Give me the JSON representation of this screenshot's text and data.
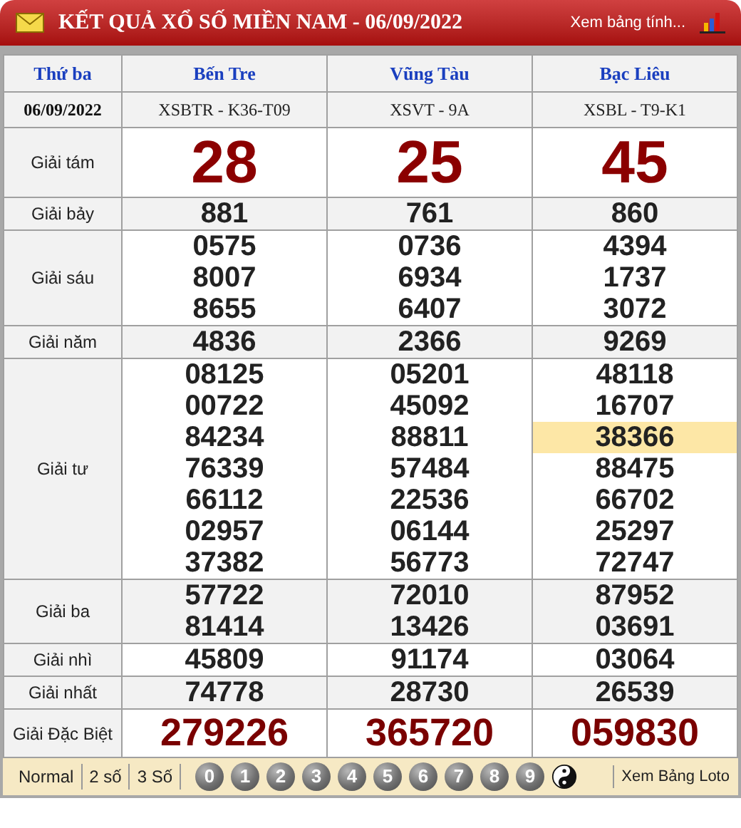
{
  "header": {
    "title": "KẾT QUẢ XỔ SỐ MIỀN NAM - 06/09/2022",
    "link": "Xem bảng tính..."
  },
  "table": {
    "day": "Thứ ba",
    "date": "06/09/2022",
    "provinces": [
      {
        "name": "Bến Tre",
        "code": "XSBTR - K36-T09"
      },
      {
        "name": "Vũng Tàu",
        "code": "XSVT - 9A"
      },
      {
        "name": "Bạc Liêu",
        "code": "XSBL - T9-K1"
      }
    ],
    "prizes": [
      {
        "label": "Giải tám",
        "kind": "eighth",
        "results": [
          [
            {
              "n": "28",
              "highlighted": false
            }
          ],
          [
            {
              "n": "25",
              "highlighted": false
            }
          ],
          [
            {
              "n": "45",
              "highlighted": false
            }
          ]
        ]
      },
      {
        "label": "Giải bảy",
        "kind": "normal",
        "results": [
          [
            {
              "n": "881",
              "highlighted": false
            }
          ],
          [
            {
              "n": "761",
              "highlighted": false
            }
          ],
          [
            {
              "n": "860",
              "highlighted": false
            }
          ]
        ]
      },
      {
        "label": "Giải sáu",
        "kind": "normal",
        "results": [
          [
            {
              "n": "0575",
              "highlighted": false
            },
            {
              "n": "8007",
              "highlighted": false
            },
            {
              "n": "8655",
              "highlighted": false
            }
          ],
          [
            {
              "n": "0736",
              "highlighted": false
            },
            {
              "n": "6934",
              "highlighted": false
            },
            {
              "n": "6407",
              "highlighted": false
            }
          ],
          [
            {
              "n": "4394",
              "highlighted": false
            },
            {
              "n": "1737",
              "highlighted": false
            },
            {
              "n": "3072",
              "highlighted": false
            }
          ]
        ]
      },
      {
        "label": "Giải năm",
        "kind": "normal",
        "results": [
          [
            {
              "n": "4836",
              "highlighted": false
            }
          ],
          [
            {
              "n": "2366",
              "highlighted": false
            }
          ],
          [
            {
              "n": "9269",
              "highlighted": false
            }
          ]
        ]
      },
      {
        "label": "Giải tư",
        "kind": "normal",
        "results": [
          [
            {
              "n": "08125",
              "highlighted": false
            },
            {
              "n": "00722",
              "highlighted": false
            },
            {
              "n": "84234",
              "highlighted": false
            },
            {
              "n": "76339",
              "highlighted": false
            },
            {
              "n": "66112",
              "highlighted": false
            },
            {
              "n": "02957",
              "highlighted": false
            },
            {
              "n": "37382",
              "highlighted": false
            }
          ],
          [
            {
              "n": "05201",
              "highlighted": false
            },
            {
              "n": "45092",
              "highlighted": false
            },
            {
              "n": "88811",
              "highlighted": false
            },
            {
              "n": "57484",
              "highlighted": false
            },
            {
              "n": "22536",
              "highlighted": false
            },
            {
              "n": "06144",
              "highlighted": false
            },
            {
              "n": "56773",
              "highlighted": false
            }
          ],
          [
            {
              "n": "48118",
              "highlighted": false
            },
            {
              "n": "16707",
              "highlighted": false
            },
            {
              "n": "38366",
              "highlighted": true
            },
            {
              "n": "88475",
              "highlighted": false
            },
            {
              "n": "66702",
              "highlighted": false
            },
            {
              "n": "25297",
              "highlighted": false
            },
            {
              "n": "72747",
              "highlighted": false
            }
          ]
        ]
      },
      {
        "label": "Giải ba",
        "kind": "normal",
        "results": [
          [
            {
              "n": "57722",
              "highlighted": false
            },
            {
              "n": "81414",
              "highlighted": false
            }
          ],
          [
            {
              "n": "72010",
              "highlighted": false
            },
            {
              "n": "13426",
              "highlighted": false
            }
          ],
          [
            {
              "n": "87952",
              "highlighted": false
            },
            {
              "n": "03691",
              "highlighted": false
            }
          ]
        ]
      },
      {
        "label": "Giải nhì",
        "kind": "normal",
        "results": [
          [
            {
              "n": "45809",
              "highlighted": false
            }
          ],
          [
            {
              "n": "91174",
              "highlighted": false
            }
          ],
          [
            {
              "n": "03064",
              "highlighted": false
            }
          ]
        ]
      },
      {
        "label": "Giải nhất",
        "kind": "normal",
        "results": [
          [
            {
              "n": "74778",
              "highlighted": false
            }
          ],
          [
            {
              "n": "28730",
              "highlighted": false
            }
          ],
          [
            {
              "n": "26539",
              "highlighted": false
            }
          ]
        ]
      },
      {
        "label": "Giải Đặc Biệt",
        "kind": "special",
        "results": [
          [
            {
              "n": "279226",
              "highlighted": false
            }
          ],
          [
            {
              "n": "365720",
              "highlighted": false
            }
          ],
          [
            {
              "n": "059830",
              "highlighted": false
            }
          ]
        ]
      }
    ]
  },
  "footer": {
    "modes": [
      "Normal",
      "2 số",
      "3 Số"
    ],
    "digits": [
      "0",
      "1",
      "2",
      "3",
      "4",
      "5",
      "6",
      "7",
      "8",
      "9"
    ],
    "link": "Xem Bảng Loto"
  }
}
